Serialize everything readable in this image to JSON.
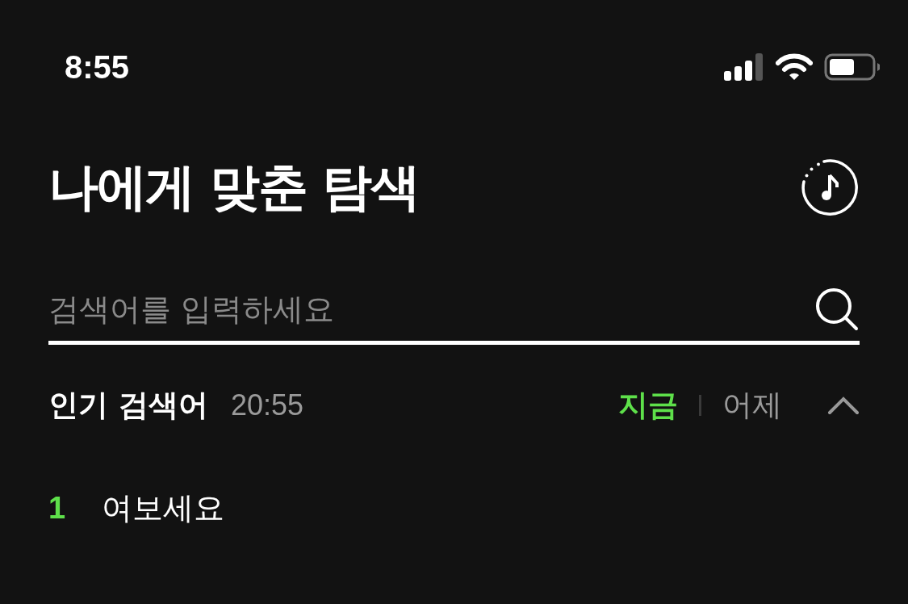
{
  "status_bar": {
    "time": "8:55"
  },
  "header": {
    "title": "나에게 맞춘 탐색"
  },
  "search": {
    "placeholder": "검색어를 입력하세요"
  },
  "popular": {
    "title": "인기 검색어",
    "time": "20:55",
    "expanded": true,
    "tabs": [
      {
        "label": "지금",
        "selected": true
      },
      {
        "label": "어제",
        "selected": false
      }
    ],
    "items": [
      {
        "rank": "1",
        "text": "여보세요"
      }
    ]
  }
}
